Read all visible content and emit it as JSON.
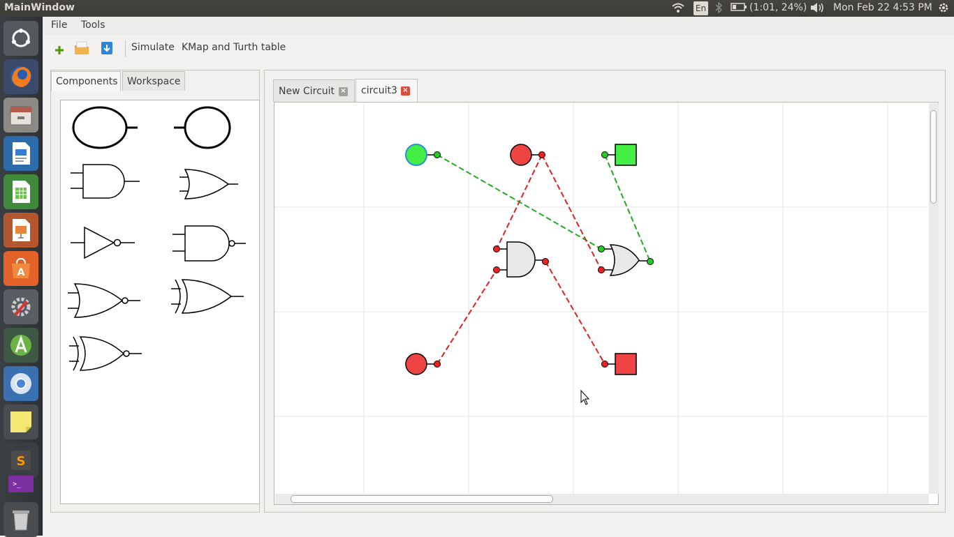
{
  "system_panel": {
    "window_title": "MainWindow",
    "keyboard_layout": "En",
    "battery": "(1:01, 24%)",
    "datetime": "Mon Feb 22  4:53 PM"
  },
  "launcher": {
    "items": [
      "ubuntu-dash",
      "firefox",
      "files",
      "writer",
      "calc",
      "impress",
      "software-center",
      "system-settings",
      "android-studio",
      "chromium",
      "sticky-notes",
      "sublime-text",
      "terminal",
      "trash"
    ]
  },
  "menubar": {
    "file": "File",
    "tools": "Tools"
  },
  "toolbar": {
    "simulate": "Simulate",
    "kmap": "KMap and Turth table"
  },
  "components_panel": {
    "tabs": [
      {
        "label": "Components",
        "active": true
      },
      {
        "label": "Workspace",
        "active": false
      }
    ],
    "components": [
      "input-node",
      "output-node",
      "and-gate",
      "or-gate",
      "not-gate",
      "nand-gate",
      "nor-gate",
      "xor-gate",
      "xnor-gate"
    ]
  },
  "workspace": {
    "tabs": [
      {
        "label": "New Circuit",
        "active": false
      },
      {
        "label": "circuit3",
        "active": true
      }
    ]
  },
  "colors": {
    "wire_high": "#22aa22",
    "wire_low": "#dd2222",
    "node_high": "#44ee44",
    "node_low": "#ee4444",
    "gate_fill": "#e8e8e8"
  }
}
